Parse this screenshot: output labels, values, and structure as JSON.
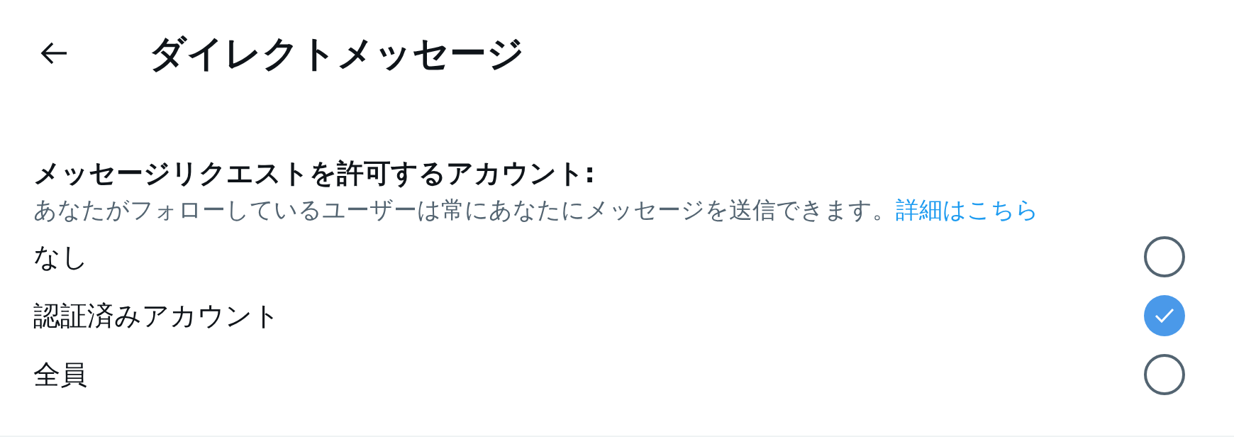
{
  "header": {
    "title": "ダイレクトメッセージ"
  },
  "section": {
    "heading": "メッセージリクエストを許可するアカウント:",
    "description": "あなたがフォローしているユーザーは常にあなたにメッセージを送信できます。",
    "link": "詳細はこちら"
  },
  "options": [
    {
      "label": "なし",
      "selected": false
    },
    {
      "label": "認証済みアカウント",
      "selected": true
    },
    {
      "label": "全員",
      "selected": false
    }
  ]
}
